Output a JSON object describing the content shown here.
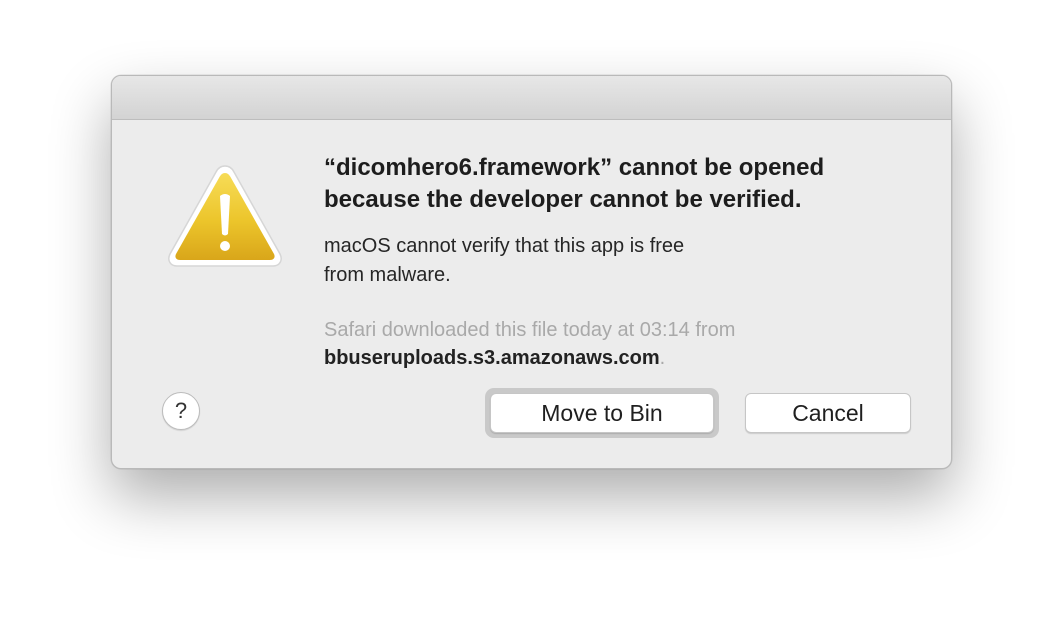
{
  "dialog": {
    "title_lines": [
      "“dicomhero6.framework” cannot be opened",
      "because the developer cannot be verified."
    ],
    "message_lines": [
      "macOS cannot verify that this app is free",
      "from malware."
    ],
    "source_prefix": "Safari downloaded this file today at 03:14 from",
    "source_domain": "bbuseruploads.s3.amazonaws.com",
    "source_suffix": ".",
    "icon": "warning-triangle-icon",
    "help_label": "?",
    "buttons": {
      "primary": "Move to Bin",
      "secondary": "Cancel"
    }
  },
  "colors": {
    "dialog_bg": "#ececec",
    "warning_yellow": "#e8c020",
    "text_primary": "#1d1d1d",
    "text_muted": "#a9a9a9"
  }
}
